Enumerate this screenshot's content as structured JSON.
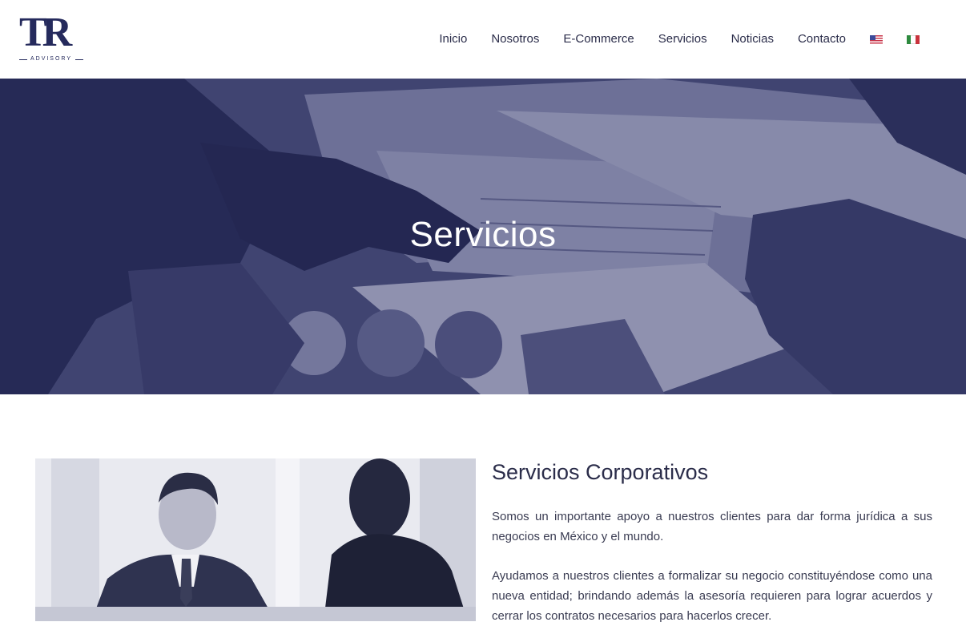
{
  "header": {
    "logo": {
      "mark": "TR",
      "subtitle": "ADVISORY"
    },
    "nav": [
      {
        "label": "Inicio"
      },
      {
        "label": "Nosotros"
      },
      {
        "label": "E-Commerce"
      },
      {
        "label": "Servicios"
      },
      {
        "label": "Noticias"
      },
      {
        "label": "Contacto"
      }
    ],
    "flags": [
      {
        "icon": "us-flag-icon"
      },
      {
        "icon": "mexico-flag-icon"
      }
    ]
  },
  "hero": {
    "title": "Servicios",
    "overlay_color": "#2d3264"
  },
  "section": {
    "title": "Servicios Corporativos",
    "paragraphs": [
      "Somos un importante apoyo a nuestros clientes para dar forma jurídica a sus negocios en México y el mundo.",
      "Ayudamos a nuestros clientes a formalizar su negocio constituyéndose como una nueva entidad; brindando además la asesoría requieren para lograr acuerdos y cerrar los contratos necesarios para hacerlos crecer."
    ]
  },
  "colors": {
    "brand": "#252a5c",
    "text": "#2b2d4a"
  }
}
